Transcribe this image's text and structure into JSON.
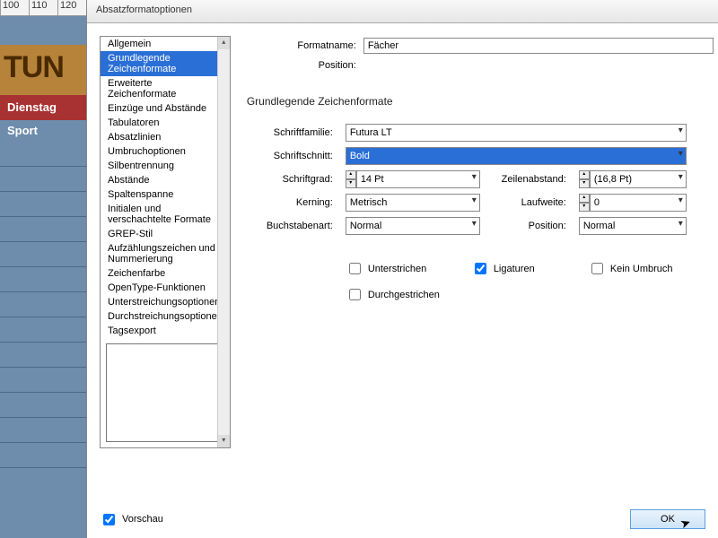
{
  "ruler": [
    "100",
    "110",
    "120"
  ],
  "bg": {
    "band": "TUN",
    "red": "Dienstag",
    "blue": "Sport"
  },
  "dialog": {
    "title": "Absatzformatoptionen",
    "categories": [
      "Allgemein",
      "Grundlegende Zeichenformate",
      "Erweiterte Zeichenformate",
      "Einzüge und Abstände",
      "Tabulatoren",
      "Absatzlinien",
      "Umbruchoptionen",
      "Silbentrennung",
      "Abstände",
      "Spaltenspanne",
      "Initialen und verschachtelte Formate",
      "GREP-Stil",
      "Aufzählungszeichen und Nummerierung",
      "Zeichenfarbe",
      "OpenType-Funktionen",
      "Unterstreichungsoptionen",
      "Durchstreichungsoptionen",
      "Tagsexport"
    ],
    "selectedIndex": 1,
    "formatname_label": "Formatname:",
    "formatname_value": "Fächer",
    "position_label": "Position:",
    "section": "Grundlegende Zeichenformate",
    "fields": {
      "family_l": "Schriftfamilie:",
      "family_v": "Futura LT",
      "style_l": "Schriftschnitt:",
      "style_v": "Bold",
      "size_l": "Schriftgrad:",
      "size_v": "14 Pt",
      "leading_l": "Zeilenabstand:",
      "leading_v": "(16,8 Pt)",
      "kerning_l": "Kerning:",
      "kerning_v": "Metrisch",
      "tracking_l": "Laufweite:",
      "tracking_v": "0",
      "case_l": "Buchstabenart:",
      "case_v": "Normal",
      "posn_l": "Position:",
      "posn_v": "Normal"
    },
    "checks": {
      "under": "Unterstrichen",
      "lig": "Ligaturen",
      "nobreak": "Kein Umbruch",
      "strike": "Durchgestrichen"
    },
    "preview": "Vorschau",
    "ok": "OK"
  }
}
